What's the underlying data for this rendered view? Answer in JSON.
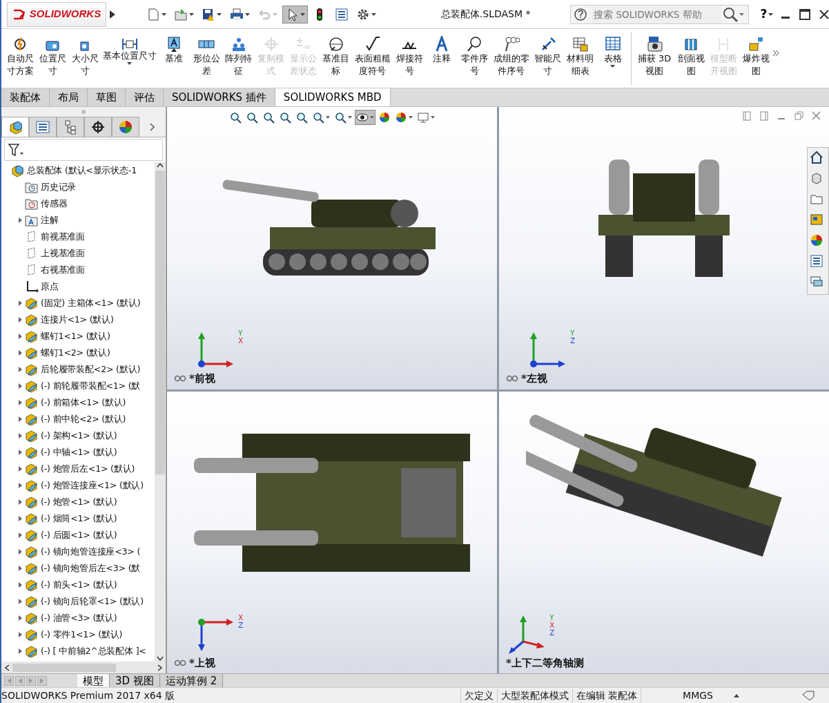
{
  "app_logo": {
    "text": "SOLIDWORKS"
  },
  "quick_access": [
    {
      "dropdown": true,
      "disabled": false,
      "selected": false
    },
    {
      "dropdown": true,
      "disabled": false,
      "selected": false
    },
    {
      "dropdown": true,
      "disabled": false,
      "selected": false
    },
    {
      "dropdown": true,
      "disabled": false,
      "selected": false
    },
    {
      "dropdown": true,
      "disabled": true,
      "selected": false
    },
    {
      "dropdown": true,
      "disabled": false,
      "selected": true
    },
    {
      "dropdown": false,
      "disabled": false,
      "selected": false
    },
    {
      "dropdown": false,
      "disabled": false,
      "selected": false
    },
    {
      "dropdown": true,
      "disabled": false,
      "selected": false
    }
  ],
  "title": "总装配体.SLDASM *",
  "search": {
    "placeholder": "搜索 SOLIDWORKS 帮助"
  },
  "help": {
    "label": "?"
  },
  "ribbon_groups": [
    [
      {
        "label": "自动尺寸方案",
        "disabled": false,
        "dropdown": false
      },
      {
        "label": "位置尺寸",
        "disabled": false,
        "dropdown": false
      },
      {
        "label": "大小尺寸",
        "disabled": false,
        "dropdown": false
      },
      {
        "label": "基本位置尺寸",
        "disabled": false,
        "dropdown": true
      },
      {
        "label": "基准",
        "disabled": false,
        "dropdown": false
      },
      {
        "label": "形位公差",
        "disabled": false,
        "dropdown": false
      },
      {
        "label": "阵列特征",
        "disabled": false,
        "dropdown": false
      },
      {
        "label": "复制模式",
        "disabled": true,
        "dropdown": false
      },
      {
        "label": "显示公差状态",
        "disabled": true,
        "dropdown": false
      },
      {
        "label": "基准目标",
        "disabled": false,
        "dropdown": false
      },
      {
        "label": "表面粗糙度符号",
        "disabled": false,
        "dropdown": false
      },
      {
        "label": "焊接符号",
        "disabled": false,
        "dropdown": false
      },
      {
        "label": "注释",
        "disabled": false,
        "dropdown": false
      },
      {
        "label": "零件序号",
        "disabled": false,
        "dropdown": false
      },
      {
        "label": "成组的零件序号",
        "disabled": false,
        "dropdown": false
      },
      {
        "label": "智能尺寸",
        "disabled": false,
        "dropdown": false
      },
      {
        "label": "材料明细表",
        "disabled": false,
        "dropdown": false
      },
      {
        "label": "表格",
        "disabled": false,
        "dropdown": true
      }
    ],
    [
      {
        "label": "捕获 3D 视图",
        "disabled": false,
        "dropdown": false
      },
      {
        "label": "剖面视图",
        "disabled": false,
        "dropdown": false
      },
      {
        "label": "模型断开视图",
        "disabled": true,
        "dropdown": false
      },
      {
        "label": "爆炸视图",
        "disabled": false,
        "dropdown": false
      }
    ]
  ],
  "command_tabs": [
    {
      "label": "装配体",
      "selected": false
    },
    {
      "label": "布局",
      "selected": false
    },
    {
      "label": "草图",
      "selected": false
    },
    {
      "label": "评估",
      "selected": false
    },
    {
      "label": "SOLIDWORKS 插件",
      "selected": false
    },
    {
      "label": "SOLIDWORKS MBD",
      "selected": true
    }
  ],
  "feature_tabs": [
    {
      "selected": true
    },
    {
      "selected": false
    },
    {
      "selected": false
    },
    {
      "selected": false
    },
    {
      "selected": false
    }
  ],
  "tree": [
    {
      "kind": "assembly",
      "label": "总装配体  (默认<显示状态-1",
      "expandable": false,
      "children": [
        {
          "kind": "history",
          "label": "历史记录",
          "expandable": false
        },
        {
          "kind": "sensors",
          "label": "传感器",
          "expandable": false
        },
        {
          "kind": "annotations",
          "label": "注解",
          "expandable": true
        },
        {
          "kind": "plane",
          "label": "前视基准面",
          "expandable": false
        },
        {
          "kind": "plane",
          "label": "上视基准面",
          "expandable": false
        },
        {
          "kind": "plane",
          "label": "右视基准面",
          "expandable": false
        },
        {
          "kind": "origin",
          "label": "原点",
          "expandable": false
        },
        {
          "kind": "part",
          "label": "(固定) 主箱体<1> (默认)",
          "expandable": true
        },
        {
          "kind": "part",
          "label": "连接片<1> (默认)",
          "expandable": true
        },
        {
          "kind": "part",
          "label": "螺钉1<1> (默认)",
          "expandable": true
        },
        {
          "kind": "part",
          "label": "螺钉1<2> (默认)",
          "expandable": true
        },
        {
          "kind": "part",
          "label": "后轮履带装配<2> (默认)",
          "expandable": true
        },
        {
          "kind": "part",
          "label": "(-) 前轮履带装配<1> (默",
          "expandable": true
        },
        {
          "kind": "part",
          "label": "(-) 前箱体<1> (默认)",
          "expandable": true
        },
        {
          "kind": "part",
          "label": "(-) 前中轮<2> (默认)",
          "expandable": true
        },
        {
          "kind": "part",
          "label": "(-) 架构<1> (默认)",
          "expandable": true
        },
        {
          "kind": "part",
          "label": "(-) 中轴<1> (默认)",
          "expandable": true
        },
        {
          "kind": "part",
          "label": "(-) 炮管后左<1> (默认)",
          "expandable": true
        },
        {
          "kind": "part",
          "label": "(-) 炮管连接座<1> (默认)",
          "expandable": true
        },
        {
          "kind": "part",
          "label": "(-) 炮管<1> (默认)",
          "expandable": true
        },
        {
          "kind": "part",
          "label": "(-) 烟筒<1> (默认)",
          "expandable": true
        },
        {
          "kind": "part",
          "label": "(-) 后圆<1> (默认)",
          "expandable": true
        },
        {
          "kind": "part",
          "label": "(-) 镜向炮管连接座<3> (",
          "expandable": true
        },
        {
          "kind": "part",
          "label": "(-) 镜向炮管后左<3> (默",
          "expandable": true
        },
        {
          "kind": "part",
          "label": "(-) 前头<1> (默认)",
          "expandable": true
        },
        {
          "kind": "part",
          "label": "(-) 镜向后轮罩<1> (默认)",
          "expandable": true
        },
        {
          "kind": "part",
          "label": "(-) 油管<3> (默认)",
          "expandable": true
        },
        {
          "kind": "part",
          "label": "(-) 零件1<1> (默认)",
          "expandable": true
        },
        {
          "kind": "part",
          "label": "(-) [ 中前轴2^总装配体 ]<",
          "expandable": true
        }
      ]
    }
  ],
  "view_toolbar": [
    {
      "dropdown": false,
      "selected": false
    },
    {
      "dropdown": false,
      "selected": false
    },
    {
      "dropdown": false,
      "selected": false
    },
    {
      "dropdown": false,
      "selected": false
    },
    {
      "dropdown": false,
      "selected": false
    },
    {
      "dropdown": true,
      "selected": false
    },
    {
      "dropdown": true,
      "selected": false
    },
    {
      "dropdown": true,
      "selected": true
    },
    {
      "dropdown": false,
      "selected": false
    },
    {
      "dropdown": true,
      "selected": false
    },
    {
      "dropdown": true,
      "selected": false
    }
  ],
  "viewports": [
    {
      "label": "*前视",
      "axes": [
        "Y",
        "X"
      ]
    },
    {
      "label": "*左视",
      "axes": [
        "Y",
        "Z"
      ]
    },
    {
      "label": "*上视",
      "axes": [
        "X",
        "Z"
      ]
    },
    {
      "label": "*上下二等角轴测",
      "axes": [
        "Y",
        "X",
        "Z"
      ]
    }
  ],
  "bottom_tabs": [
    {
      "label": "模型",
      "selected": true
    },
    {
      "label": "3D 视图",
      "selected": false
    },
    {
      "label": "运动算例 2",
      "selected": false
    }
  ],
  "status_bar": {
    "product": "SOLIDWORKS Premium 2017 x64 版",
    "fields": [
      "欠定义",
      "大型装配体模式",
      "在编辑 装配体",
      "MMGS"
    ]
  }
}
